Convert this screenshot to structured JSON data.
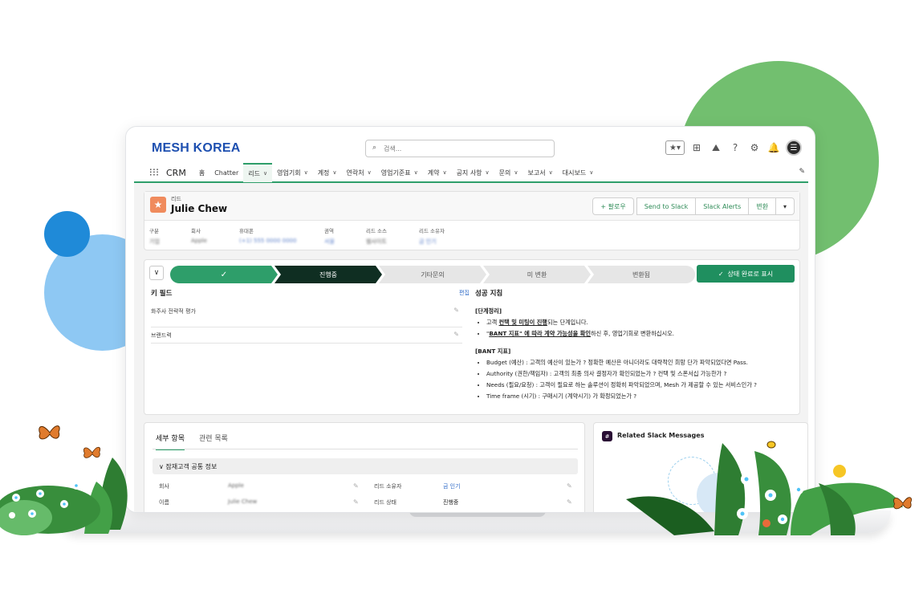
{
  "colors": {
    "accent_green": "#2e9e6a",
    "brand_blue": "#1d4fb0",
    "current_step": "#0f2e22",
    "lead_icon": "#f08b5d"
  },
  "header": {
    "logo": "MESH KOREA",
    "search_placeholder": "검색...",
    "icons": [
      "favorites-star-icon",
      "add-icon",
      "trailhead-icon",
      "help-icon",
      "settings-gear-icon",
      "notifications-bell-icon",
      "user-avatar"
    ]
  },
  "nav": {
    "app_name": "CRM",
    "items": [
      {
        "label": "홈",
        "dropdown": false
      },
      {
        "label": "Chatter",
        "dropdown": false
      },
      {
        "label": "리드",
        "dropdown": true,
        "active": true
      },
      {
        "label": "영업기회",
        "dropdown": true
      },
      {
        "label": "계정",
        "dropdown": true
      },
      {
        "label": "연락처",
        "dropdown": true
      },
      {
        "label": "영업기준표",
        "dropdown": true
      },
      {
        "label": "계약",
        "dropdown": true
      },
      {
        "label": "공지 사항",
        "dropdown": true
      },
      {
        "label": "문의",
        "dropdown": true
      },
      {
        "label": "보고서",
        "dropdown": true
      },
      {
        "label": "대시보드",
        "dropdown": true
      }
    ]
  },
  "record": {
    "type": "리드",
    "name": "Julie Chew",
    "actions": {
      "follow": "+ 팔로우",
      "send_to_slack": "Send to Slack",
      "slack_alerts": "Slack Alerts",
      "convert": "변환",
      "more": "▾"
    },
    "fields": [
      {
        "label": "구분",
        "value": "기업"
      },
      {
        "label": "회사",
        "value": "Apple"
      },
      {
        "label": "휴대폰",
        "value": "(+1) 555 0000 0000"
      },
      {
        "label": "권역",
        "value": "서울"
      },
      {
        "label": "리드 소스",
        "value": "웹사이트"
      },
      {
        "label": "리드 소유자",
        "value": "금 인기"
      }
    ]
  },
  "path": {
    "steps": [
      "✓",
      "진행중",
      "기타문의",
      "미 변환",
      "변환됨"
    ],
    "done_index": 0,
    "current_index": 1,
    "mark_button": "상태 완료로 표시"
  },
  "key_fields": {
    "title": "키 필드",
    "edit": "편집",
    "rows": [
      "화주사 전략적 평가",
      "브랜드력"
    ]
  },
  "guidance": {
    "title": "성공 지침",
    "stage_heading": "[단계정리]",
    "stage_items": [
      {
        "pre": "고객 ",
        "emph": "컨택 및 미팅이 진행",
        "post": "되는 단계입니다."
      },
      {
        "pre": "\"",
        "emph": "BANT 지표\" 에 따라 계약 가능성을 확인",
        "post": "하신 후, 영업기회로 변환하십시오."
      }
    ],
    "bant_heading": "[BANT 지표]",
    "bant_items": [
      "Budget (예산) : 고객의 예산이 있는가 ? 정확한 예산은 아니더라도 대략적인 희망 단가 파악되었다면 Pass.",
      "Authority (권한/책임자) : 고객의 최종 의사 결정자가 확인되었는가 ? 컨택 및 스폰서십 가능한가 ?",
      "Needs (필요/요청) : 고객이 필요로 하는 솔루션이 정확히 파악되었으며, Mesh 가 제공할 수 있는 서비스인가 ?",
      "Time frame (시기) : 구매시기 (계약시기) 가 확정되었는가 ?"
    ]
  },
  "detail": {
    "tabs": [
      "세부 항목",
      "관련 목록"
    ],
    "section": "잠재고객 공통 정보",
    "rows_left": [
      {
        "label": "회사",
        "value": "Apple"
      },
      {
        "label": "이름",
        "value": "Julie Chew"
      }
    ],
    "rows_right": [
      {
        "label": "리드 소유자",
        "value": "금 인기"
      },
      {
        "label": "리드 상태",
        "value": "진행중"
      }
    ]
  },
  "slack": {
    "title": "Related Slack Messages"
  }
}
